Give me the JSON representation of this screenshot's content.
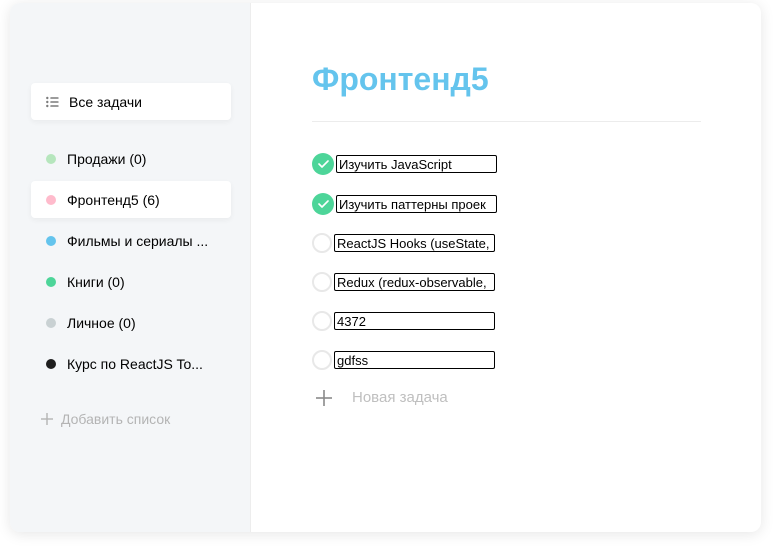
{
  "sidebar": {
    "all_tasks": {
      "label": "Все задачи",
      "icon": "list-icon"
    },
    "lists": [
      {
        "label": "Продажи (0)",
        "color": "#b6e6bd"
      },
      {
        "label": "Фронтенд5 (6)",
        "color": "#ffbbcc",
        "active": true
      },
      {
        "label": "Фильмы и сериалы ...",
        "color": "#64c4ed"
      },
      {
        "label": "Книги (0)",
        "color": "#4dd599"
      },
      {
        "label": "Личное (0)",
        "color": "#c9d1d3"
      },
      {
        "label": "Курс по ReactJS To...",
        "color": "#1e1e1e"
      }
    ],
    "add_list_label": "Добавить список"
  },
  "main": {
    "title": "Фронтенд5",
    "title_color": "#64c4ed",
    "tasks": [
      {
        "text": "Изучить JavaScript",
        "completed": true
      },
      {
        "text": "Изучить паттерны проек",
        "completed": true
      },
      {
        "text": "ReactJS Hooks (useState,",
        "completed": false
      },
      {
        "text": "Redux (redux-observable,",
        "completed": false
      },
      {
        "text": "4372",
        "completed": false
      },
      {
        "text": "gdfss",
        "completed": false
      }
    ],
    "new_task_label": "Новая задача"
  },
  "colors": {
    "check_done": "#4dd599",
    "sidebar_bg": "#f4f6f8"
  }
}
